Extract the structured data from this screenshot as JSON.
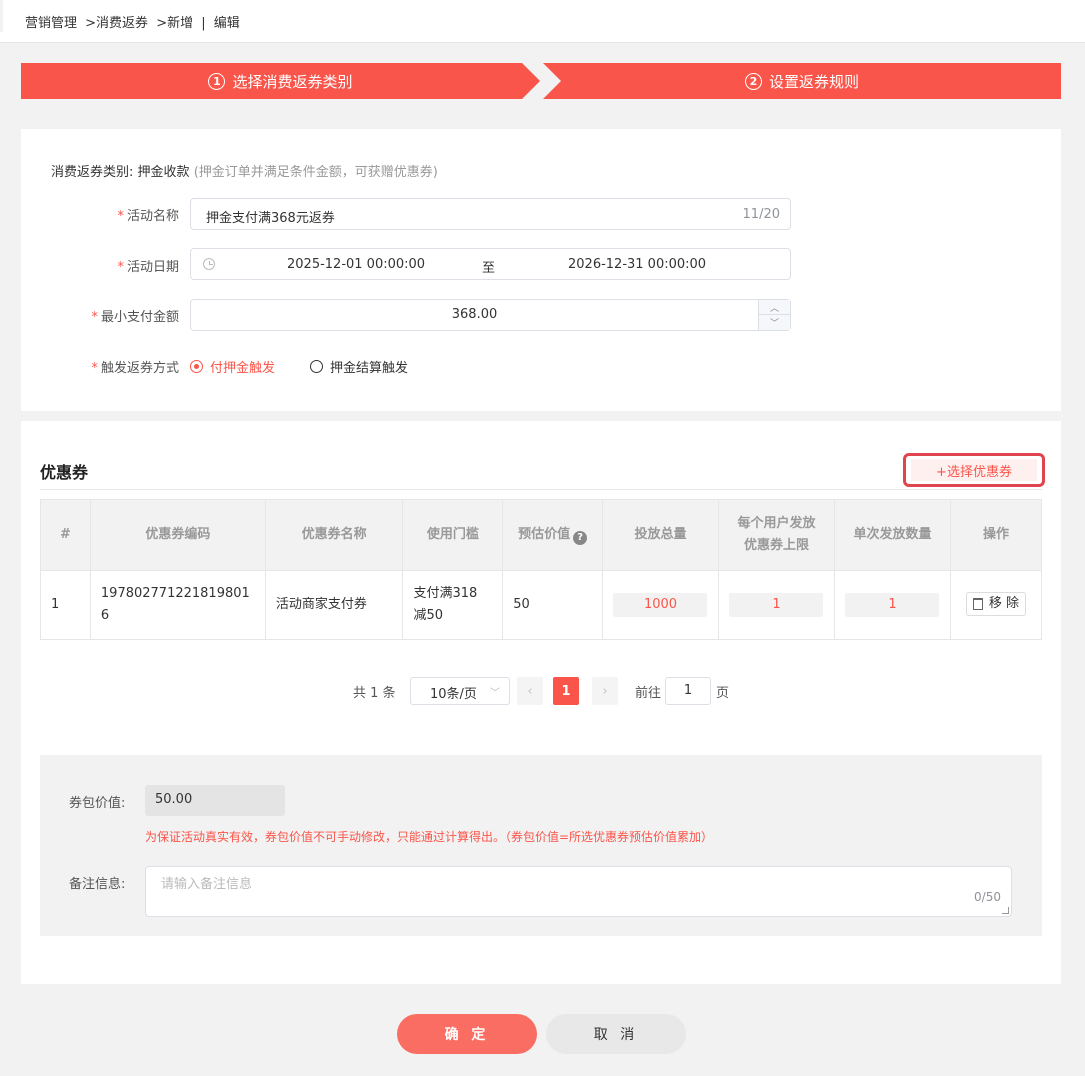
{
  "breadcrumb": [
    "营销管理",
    ">消费返券",
    ">新增",
    "|",
    "编辑"
  ],
  "steps": [
    {
      "num": "1",
      "label": "选择消费返券类别"
    },
    {
      "num": "2",
      "label": "设置返券规则"
    }
  ],
  "type_line": {
    "label": "消费返券类别:",
    "value": "押金收款",
    "hint": "(押金订单并满足条件金额，可获赠优惠券)"
  },
  "form": {
    "activity_name": {
      "label": "活动名称",
      "value": "押金支付满368元返券",
      "count": "11/20"
    },
    "activity_date": {
      "label": "活动日期",
      "start": "2025-12-01 00:00:00",
      "separator": "至",
      "end": "2026-12-31 00:00:00"
    },
    "min_amount": {
      "label": "最小支付金额",
      "value": "368.00"
    },
    "trigger": {
      "label": "触发返券方式",
      "options": [
        "付押金触发",
        "押金结算触发"
      ],
      "selected": "付押金触发"
    }
  },
  "coupons": {
    "title": "优惠券",
    "select_button": "+选择优惠券",
    "columns": [
      "#",
      "优惠券编码",
      "优惠券名称",
      "使用门槛",
      "预估价值",
      "投放总量",
      "每个用户发放优惠券上限",
      "单次发放数量",
      "操作"
    ],
    "column_lines": {
      "per_user_1": "每个用户发放",
      "per_user_2": "优惠券上限"
    },
    "rows": [
      {
        "index": "1",
        "code_1": "197802771221819801",
        "code_2": "6",
        "name": "活动商家支付券",
        "threshold_1": "支付满318",
        "threshold_2": "减50",
        "value": "50",
        "total": "1000",
        "per_user": "1",
        "per_issue": "1",
        "action": "移 除"
      }
    ]
  },
  "pagination": {
    "total": "共 1 条",
    "page_size": "10条/页",
    "current": "1",
    "goto_label": "前往",
    "goto_value": "1",
    "page_unit": "页"
  },
  "package": {
    "label": "券包价值:",
    "value": "50.00",
    "hint": "为保证活动真实有效，券包价值不可手动修改，只能通过计算得出。（券包价值=所选优惠券预估价值累加）"
  },
  "remark": {
    "label": "备注信息:",
    "placeholder": "请输入备注信息",
    "count": "0/50"
  },
  "buttons": {
    "confirm": "确 定",
    "cancel": "取 消"
  },
  "colors": {
    "accent": "#fa554a",
    "page_bg": "#f2f2f2"
  }
}
